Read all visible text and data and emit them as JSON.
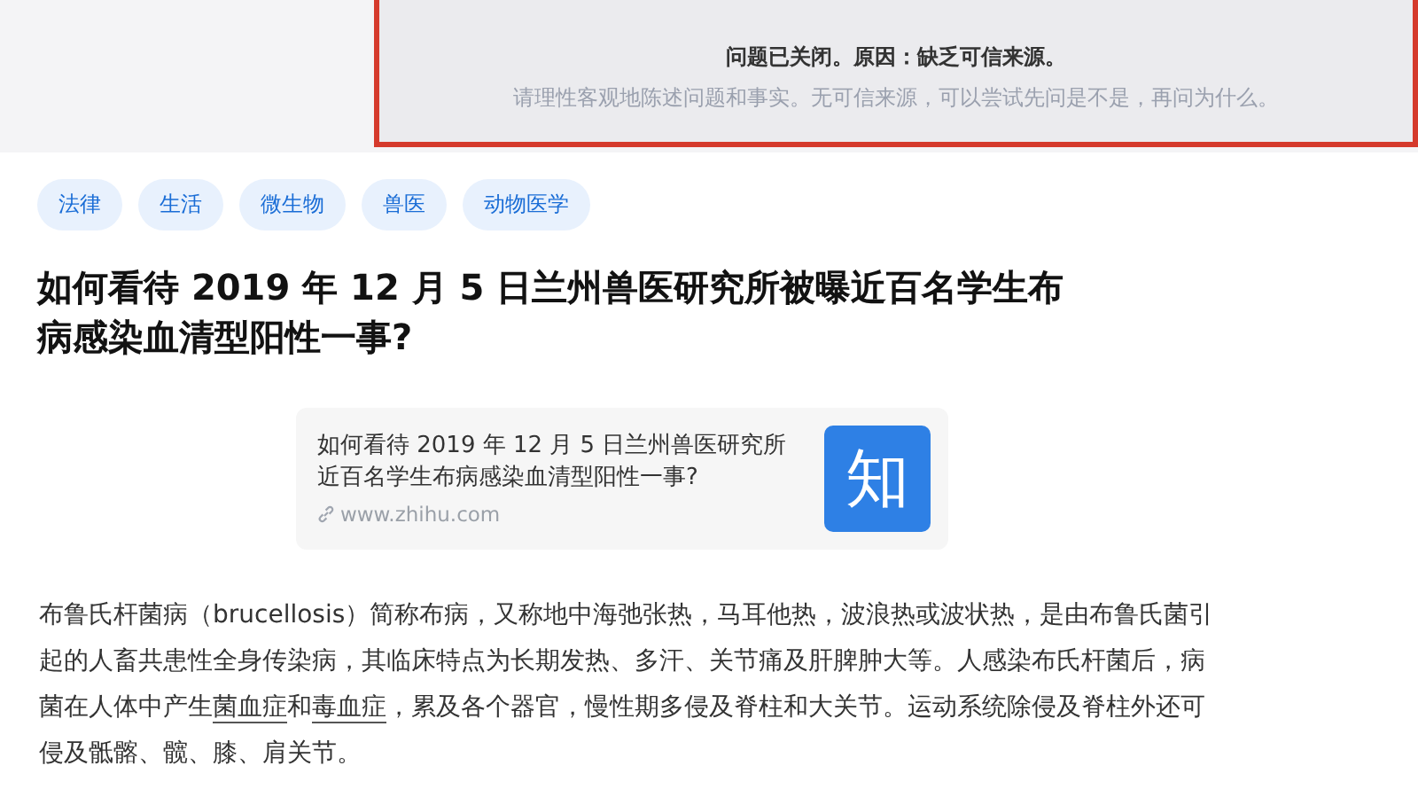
{
  "notice": {
    "title": "问题已关闭。原因：缺乏可信来源。",
    "message": "请理性客观地陈述问题和事实。无可信来源，可以尝试先问是不是，再问为什么。"
  },
  "tags": [
    "法律",
    "生活",
    "微生物",
    "兽医",
    "动物医学"
  ],
  "question": {
    "title": "如何看待 2019 年 12 月 5 日兰州兽医研究所被曝近百名学生布病感染血清型阳性一事?"
  },
  "link_card": {
    "title": "如何看待 2019 年 12 月 5 日兰州兽医研究所近百名学生布病感染血清型阳性一事?",
    "url": "www.zhihu.com",
    "logo": "知"
  },
  "paragraph": [
    {
      "kind": "text",
      "text": "布鲁氏杆菌病（brucellosis）简称布病，又称地中海弛张热，马耳他热，波浪热或波状热，是由布鲁氏菌引起的人畜共患性全身传染病，其临床特点为长期发热、多汗、关节痛及肝脾肿大等。人感染布氏杆菌后，病菌在人体中产生"
    },
    {
      "kind": "link",
      "text": "菌血症"
    },
    {
      "kind": "text",
      "text": "和"
    },
    {
      "kind": "link",
      "text": "毒血症"
    },
    {
      "kind": "text",
      "text": "，累及各个器官，慢性期多侵及脊柱和大关节。运动系统除侵及脊柱外还可侵及骶髂、髋、膝、肩关节。"
    }
  ]
}
